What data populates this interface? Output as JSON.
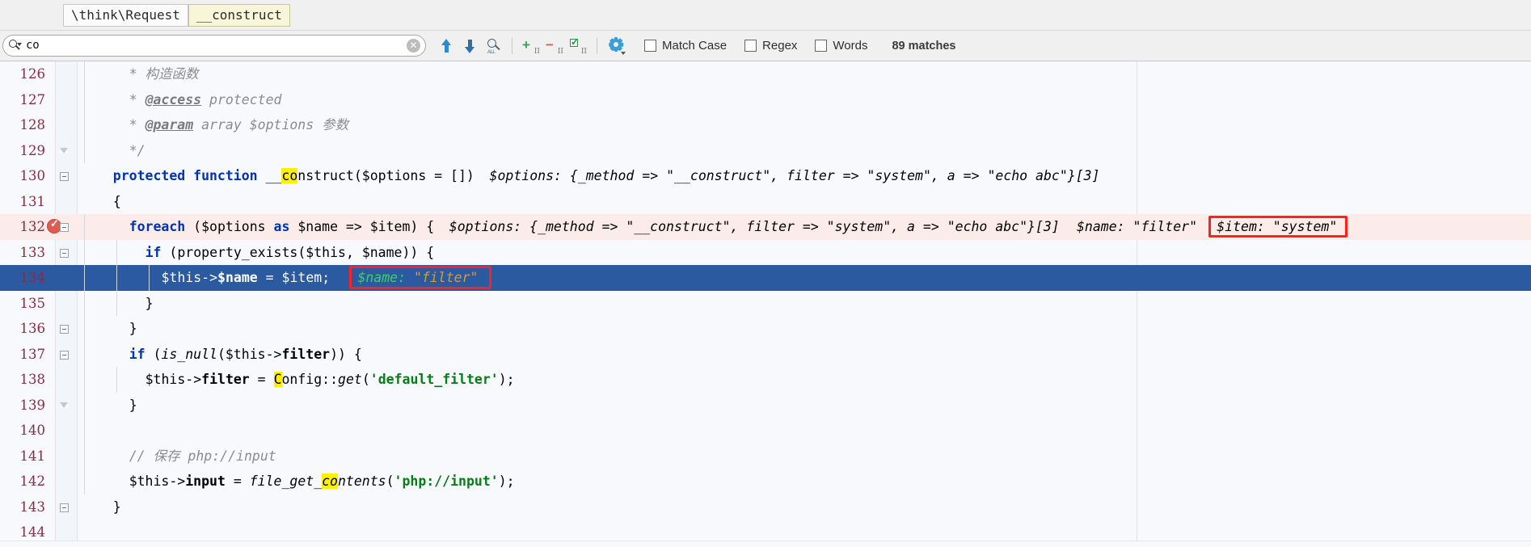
{
  "breadcrumb": {
    "items": [
      {
        "label": "\\think\\Request",
        "active": false
      },
      {
        "label": "__construct",
        "active": true
      }
    ]
  },
  "find_bar": {
    "search_value": "co",
    "search_placeholder": "Search",
    "icons": {
      "search": "search-icon",
      "clear": "clear-search-icon",
      "prev": "find-previous-icon",
      "next": "find-next-icon",
      "find_all": "find-all-icon",
      "add_selection": "add-selection-icon",
      "remove_selection": "remove-selection-icon",
      "select_all_occurrences": "select-all-occurrences-icon",
      "settings": "filter-settings-gear-icon"
    },
    "options": [
      {
        "label": "Match Case",
        "mnemonic": "C",
        "checked": false
      },
      {
        "label": "Regex",
        "mnemonic": "g",
        "checked": false
      },
      {
        "label": "Words",
        "mnemonic": "r",
        "checked": false
      }
    ],
    "match_count": "89 matches"
  },
  "editor": {
    "search_term": "co",
    "highlight_color": "#ffef00",
    "selection_color": "#2c5aa0",
    "breakpoint_row_color": "#fbece9",
    "annotation_color": "#ff2020",
    "lines": [
      {
        "number": "126",
        "indent": 3,
        "segments": [
          {
            "t": "* 构造函数",
            "c": "cmt"
          }
        ]
      },
      {
        "number": "127",
        "indent": 3,
        "segments": [
          {
            "t": "* ",
            "c": "cmt"
          },
          {
            "t": "@access",
            "c": "tag"
          },
          {
            "t": " protected",
            "c": "cmt"
          }
        ]
      },
      {
        "number": "128",
        "indent": 3,
        "segments": [
          {
            "t": "* ",
            "c": "cmt"
          },
          {
            "t": "@param",
            "c": "tag"
          },
          {
            "t": " array $options 参数",
            "c": "cmt"
          }
        ]
      },
      {
        "number": "129",
        "indent": 3,
        "fold": "tri-dn",
        "segments": [
          {
            "t": "*/",
            "c": "cmt"
          }
        ]
      },
      {
        "number": "130",
        "indent": 2,
        "fold": "sq",
        "segments": [
          {
            "t": "protected function ",
            "c": "kw"
          },
          {
            "t": "__",
            "c": "fn"
          },
          {
            "t": "co",
            "c": "fn hl"
          },
          {
            "t": "nstruct",
            "c": "fn"
          },
          {
            "t": "($options = [])",
            "c": "var"
          }
        ],
        "hint": "$options: {_method => \"__construct\", filter => \"system\", a => \"echo abc\"}[3]"
      },
      {
        "number": "131",
        "indent": 2,
        "segments": [
          {
            "t": "{",
            "c": "var"
          }
        ]
      },
      {
        "number": "132",
        "indent": 3,
        "breakpoint": true,
        "rowstyle": "highlight-bp",
        "fold": "sq",
        "segments": [
          {
            "t": "foreach ",
            "c": "kw"
          },
          {
            "t": "($options ",
            "c": "var"
          },
          {
            "t": "as ",
            "c": "kw"
          },
          {
            "t": "$name => $item) {",
            "c": "var"
          }
        ],
        "hint": "$options: {_method => \"__construct\", filter => \"system\", a => \"echo abc\"}[3]",
        "hint2": "$name: \"filter\"",
        "hint_boxed": "$item: \"system\""
      },
      {
        "number": "133",
        "indent": 4,
        "fold": "sq",
        "segments": [
          {
            "t": "if ",
            "c": "kw"
          },
          {
            "t": "(property_exists($this, $name)) {",
            "c": "var"
          }
        ]
      },
      {
        "number": "134",
        "indent": 5,
        "rowstyle": "selected",
        "segments": [
          {
            "t": "$this->",
            "c": "selw"
          },
          {
            "t": "$name",
            "c": "selwb"
          },
          {
            "t": " = $item;",
            "c": "selw"
          }
        ],
        "hint_boxed_sel": "$name: \"filter\""
      },
      {
        "number": "135",
        "indent": 4,
        "segments": [
          {
            "t": "}",
            "c": "var"
          }
        ]
      },
      {
        "number": "136",
        "indent": 3,
        "fold": "sq",
        "segments": [
          {
            "t": "}",
            "c": "var"
          }
        ]
      },
      {
        "number": "137",
        "indent": 3,
        "fold": "sq",
        "segments": [
          {
            "t": "if ",
            "c": "kw"
          },
          {
            "t": "(",
            "c": "var"
          },
          {
            "t": "is_null",
            "c": "ital"
          },
          {
            "t": "($this->",
            "c": "var"
          },
          {
            "t": "filter",
            "c": "varb"
          },
          {
            "t": ")) {",
            "c": "var"
          }
        ]
      },
      {
        "number": "138",
        "indent": 4,
        "segments": [
          {
            "t": "$this->",
            "c": "var"
          },
          {
            "t": "filter",
            "c": "varb"
          },
          {
            "t": " = ",
            "c": "var"
          },
          {
            "t": "C",
            "c": "var hl"
          },
          {
            "t": "onfig::",
            "c": "var"
          },
          {
            "t": "get",
            "c": "ital"
          },
          {
            "t": "(",
            "c": "var"
          },
          {
            "t": "'default_filter'",
            "c": "str"
          },
          {
            "t": ");",
            "c": "var"
          }
        ]
      },
      {
        "number": "139",
        "indent": 3,
        "fold": "tri-dn",
        "segments": [
          {
            "t": "}",
            "c": "var"
          }
        ]
      },
      {
        "number": "140",
        "indent": 3,
        "segments": [
          {
            "t": "",
            "c": "var"
          }
        ]
      },
      {
        "number": "141",
        "indent": 3,
        "segments": [
          {
            "t": "// 保存 php://input",
            "c": "cmt"
          }
        ]
      },
      {
        "number": "142",
        "indent": 3,
        "segments": [
          {
            "t": "$this->",
            "c": "var"
          },
          {
            "t": "input",
            "c": "varb"
          },
          {
            "t": " = ",
            "c": "var"
          },
          {
            "t": "file_get_",
            "c": "ital"
          },
          {
            "t": "co",
            "c": "ital hl"
          },
          {
            "t": "ntents",
            "c": "ital"
          },
          {
            "t": "(",
            "c": "var"
          },
          {
            "t": "'php://input'",
            "c": "str"
          },
          {
            "t": ");",
            "c": "var"
          }
        ]
      },
      {
        "number": "143",
        "indent": 2,
        "fold": "sq",
        "segments": [
          {
            "t": "}",
            "c": "var"
          }
        ]
      },
      {
        "number": "144",
        "indent": 2,
        "segments": [
          {
            "t": "",
            "c": "var"
          }
        ]
      }
    ]
  }
}
